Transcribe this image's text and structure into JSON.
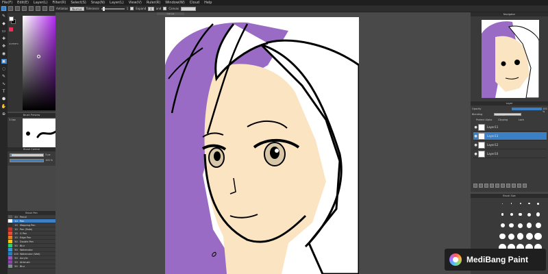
{
  "menu": [
    "File(F)",
    "Edit(E)",
    "Layer(L)",
    "Filter(R)",
    "Select(S)",
    "Snap(N)",
    "Layer(L)",
    "View(V)",
    "Ruler(R)",
    "Window(W)",
    "Cloud",
    "Help"
  ],
  "toolbar": {
    "antialias_label": "Antialias",
    "antialias_value": "Normal",
    "tolerance_label": "Tolerance",
    "tolerance_value": "1",
    "expand_label": "Expand",
    "expand_value": "0",
    "ref_label": "and",
    "canvas_label": "Canvas"
  },
  "tools": [
    "✎",
    "◆",
    "▭",
    "✚",
    "✥",
    "◉",
    "▣",
    "◌",
    "✎",
    "∿",
    "T",
    "⬢",
    "✋",
    "⊕"
  ],
  "color": {
    "hex": "#AF88F0",
    "fg": "#ffffff",
    "bg": "#000000",
    "accent": "#3b7fc4"
  },
  "brush_preview": {
    "title": "Brush Preview",
    "size_label": "3.0px"
  },
  "brush_control": {
    "title": "Brush Control",
    "size_value": "3 px",
    "opacity_value": "100 %"
  },
  "brush_list": {
    "title": "Brush Pen",
    "items": [
      {
        "size": "20",
        "name": "Pencil",
        "color": "#555555"
      },
      {
        "size": "10",
        "name": "Pen",
        "color": "#ffffff",
        "selected": true
      },
      {
        "size": "10",
        "name": "Mapping Pen",
        "color": "#333333"
      },
      {
        "size": "10",
        "name": "Pen (Fade)",
        "color": "#c0392b"
      },
      {
        "size": "15",
        "name": "G Pen",
        "color": "#e74c3c"
      },
      {
        "size": "10",
        "name": "Edge Pen",
        "color": "#e67e22"
      },
      {
        "size": "50",
        "name": "Double Pen",
        "color": "#f1c40f"
      },
      {
        "size": "50",
        "name": "Blur",
        "color": "#2ecc71"
      },
      {
        "size": "50",
        "name": "Watercolor",
        "color": "#3498db"
      },
      {
        "size": "100",
        "name": "Watercolor (Wet)",
        "color": "#2980b9"
      },
      {
        "size": "50",
        "name": "Acrylic",
        "color": "#9b59b6"
      },
      {
        "size": "20",
        "name": "Airbrush",
        "color": "#8e44ad"
      },
      {
        "size": "50",
        "name": "Blur",
        "color": "#7f8c8d"
      }
    ]
  },
  "canvas": {
    "tab": "Canvas"
  },
  "navigator": {
    "title": "Navigator"
  },
  "layers": {
    "title": "Layer",
    "opacity_label": "Opacity",
    "opacity_value": "100 %",
    "blending_label": "Blending",
    "blending_value": "Normal",
    "options": [
      "Protect Alpha",
      "Clipping",
      "Lock"
    ],
    "items": [
      {
        "name": "Layer11",
        "selected": false
      },
      {
        "name": "Layer13",
        "selected": true
      },
      {
        "name": "Layer12",
        "selected": false
      },
      {
        "name": "Layer10",
        "selected": false
      }
    ]
  },
  "brush_size_panel": {
    "title": "Brush Size"
  },
  "watermark": {
    "text": "MediBang Paint"
  }
}
